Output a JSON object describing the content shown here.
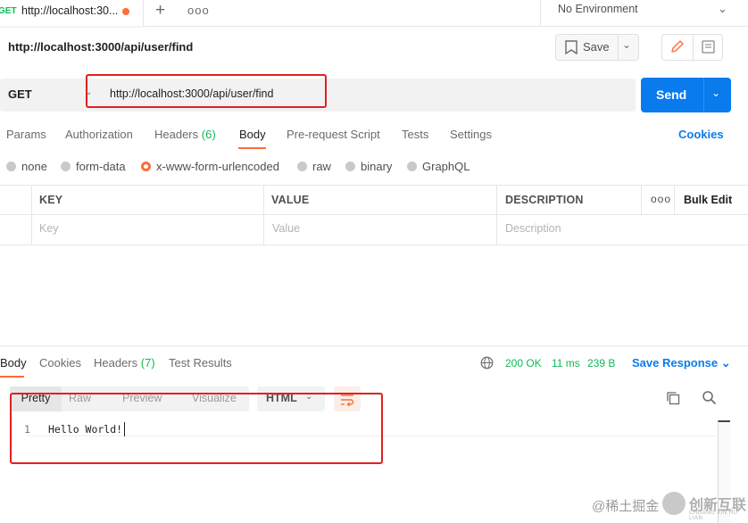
{
  "tabs": {
    "active": {
      "method": "GET",
      "label": "http://localhost:30..."
    },
    "new_tab_glyph": "+",
    "more_glyph": "ooo"
  },
  "environment": {
    "label": "No Environment"
  },
  "request": {
    "title": "http://localhost:3000/api/user/find",
    "save_label": "Save",
    "method": "GET",
    "url": "http://localhost:3000/api/user/find",
    "send_label": "Send"
  },
  "request_tabs": [
    {
      "label": "Params"
    },
    {
      "label": "Authorization"
    },
    {
      "label": "Headers",
      "count": "(6)"
    },
    {
      "label": "Body"
    },
    {
      "label": "Pre-request Script"
    },
    {
      "label": "Tests"
    },
    {
      "label": "Settings"
    }
  ],
  "cookies_label": "Cookies",
  "body_types": [
    "none",
    "form-data",
    "x-www-form-urlencoded",
    "raw",
    "binary",
    "GraphQL"
  ],
  "body_type_selected": "x-www-form-urlencoded",
  "kv_table": {
    "headers": [
      "KEY",
      "VALUE",
      "DESCRIPTION"
    ],
    "more": "ooo",
    "bulk_edit": "Bulk Edit",
    "placeholders": [
      "Key",
      "Value",
      "Description"
    ]
  },
  "response": {
    "tabs": [
      {
        "label": "Body"
      },
      {
        "label": "Cookies"
      },
      {
        "label": "Headers",
        "count": "(7)"
      },
      {
        "label": "Test Results"
      }
    ],
    "status": "200 OK",
    "time": "11 ms",
    "size": "239 B",
    "save_response": "Save Response",
    "views": [
      "Pretty",
      "Raw",
      "Preview",
      "Visualize"
    ],
    "view_selected": "Pretty",
    "language": "HTML",
    "lines": [
      {
        "no": "1",
        "text": "Hello World!"
      }
    ]
  },
  "watermark": {
    "left_text": "@稀土掘金",
    "brand": "创新互联",
    "brand_sub": "CHUANG XIN HU LIAN"
  },
  "colors": {
    "accent_orange": "#ff6c37",
    "send_blue": "#097bed",
    "status_green": "#0cbb52",
    "annotation_red": "#e02020"
  },
  "icons": [
    "pencil-icon",
    "document-icon",
    "save-icon",
    "chevron-down-icon",
    "globe-icon",
    "copy-icon",
    "search-icon",
    "wrap-lines-icon"
  ]
}
